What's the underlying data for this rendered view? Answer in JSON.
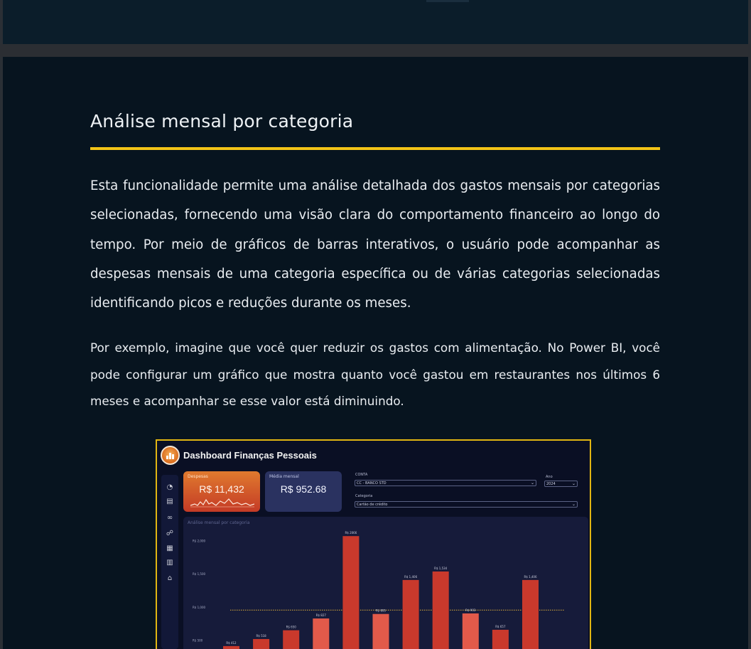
{
  "article": {
    "heading": "Análise mensal por categoria",
    "paragraph1": "Esta funcionalidade permite uma análise detalhada dos gastos mensais por categorias selecionadas, fornecendo uma visão clara do comportamento financeiro ao longo do tempo. Por meio de gráficos de barras interativos, o usuário pode acompanhar as despesas mensais de uma categoria específica ou de várias categorias selecionadas identificando picos e reduções durante os meses.",
    "paragraph2": "Por exemplo, imagine que você quer reduzir os gastos com alimentação. No Power BI, você pode configurar um gráfico que mostra quanto você gastou em restaurantes nos últimos 6 meses e acompanhar se esse valor está diminuindo."
  },
  "colors": {
    "accent": "#f2c417",
    "page_bg": "#07141f",
    "bar": "#c9392c",
    "bar_highlight": "#e25a4a",
    "average_line": "#e0b23a"
  },
  "dashboard": {
    "title": "Dashboard Finanças Pessoais",
    "nav_icons": [
      "pie-chart-icon",
      "document-icon",
      "link-icon",
      "group-icon",
      "calendar-icon",
      "table-icon",
      "bank-icon"
    ],
    "kpi_expenses": {
      "label": "Despesas",
      "value": "R$ 11,432",
      "icon": "sparkline-icon"
    },
    "kpi_average": {
      "label": "Média mensal",
      "value": "R$ 952.68"
    },
    "filters": {
      "account_label": "CONTA",
      "account_value": "CC - BANCO STD",
      "year_label": "Ano",
      "year_value": "2024",
      "category_label": "Categoria",
      "category_value": "Cartão de crédito"
    },
    "chart_title": "Análise mensal por categoria"
  },
  "chart_data": {
    "type": "bar",
    "title": "Análise mensal por categoria",
    "ytick_labels": [
      "R$ 2,000",
      "R$ 1,500",
      "R$ 1,000",
      "R$ 500"
    ],
    "ylim": [
      400,
      2100
    ],
    "average_line": 953,
    "average_line_style": "dotted",
    "series": [
      {
        "values": [
          412,
          518,
          650,
          827,
          2066,
          895,
          1406,
          1534,
          903,
          657,
          1406
        ],
        "labels": [
          "R$ 412",
          "R$ 518",
          "R$ 650",
          "R$ 827",
          "R$ 2066",
          "R$ 895",
          "R$ 1,406",
          "R$ 1,534",
          "R$ 903",
          "R$ 657",
          "R$ 1,406"
        ]
      }
    ],
    "highlighted_bars": [
      3,
      5,
      8
    ],
    "grid": false,
    "legend": "none"
  }
}
